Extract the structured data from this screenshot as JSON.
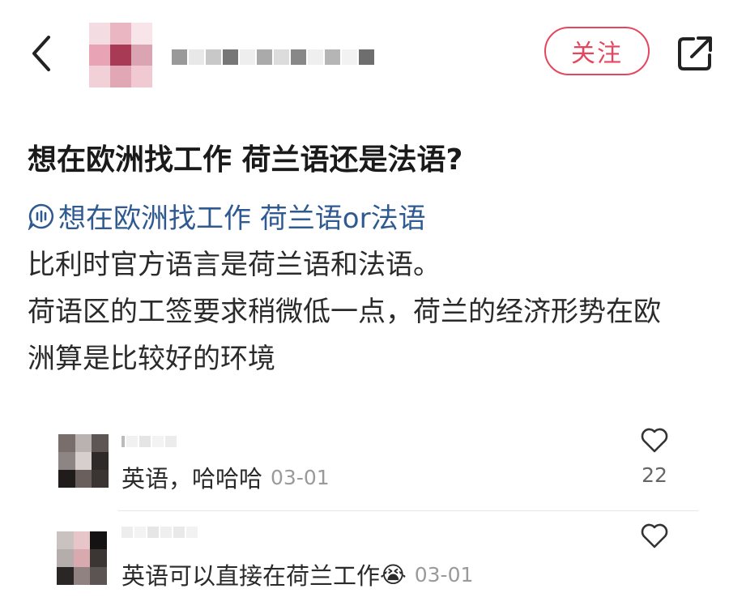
{
  "header": {
    "follow_label": "关注"
  },
  "post": {
    "title": "想在欧洲找工作 荷兰语还是法语?",
    "topic": "想在欧洲找工作 荷兰语or法语",
    "body_lines": [
      "比利时官方语言是荷兰语和法语。",
      "荷语区的工签要求稍微低一点，荷兰的经济形势在欧",
      "洲算是比较好的环境"
    ]
  },
  "comments": [
    {
      "text": "英语，哈哈哈",
      "date": "03-01",
      "likes": "22"
    },
    {
      "text": "英语可以直接在荷兰工作",
      "emoji": "😭",
      "date": "03-01",
      "likes": ""
    }
  ],
  "icons": {
    "back": "chevron-left-icon",
    "share": "share-icon",
    "topic": "topic-chat-icon",
    "like": "heart-icon"
  },
  "colors": {
    "accent": "#e5465d",
    "topic": "#2f5a91",
    "date": "#9a9a9a"
  }
}
